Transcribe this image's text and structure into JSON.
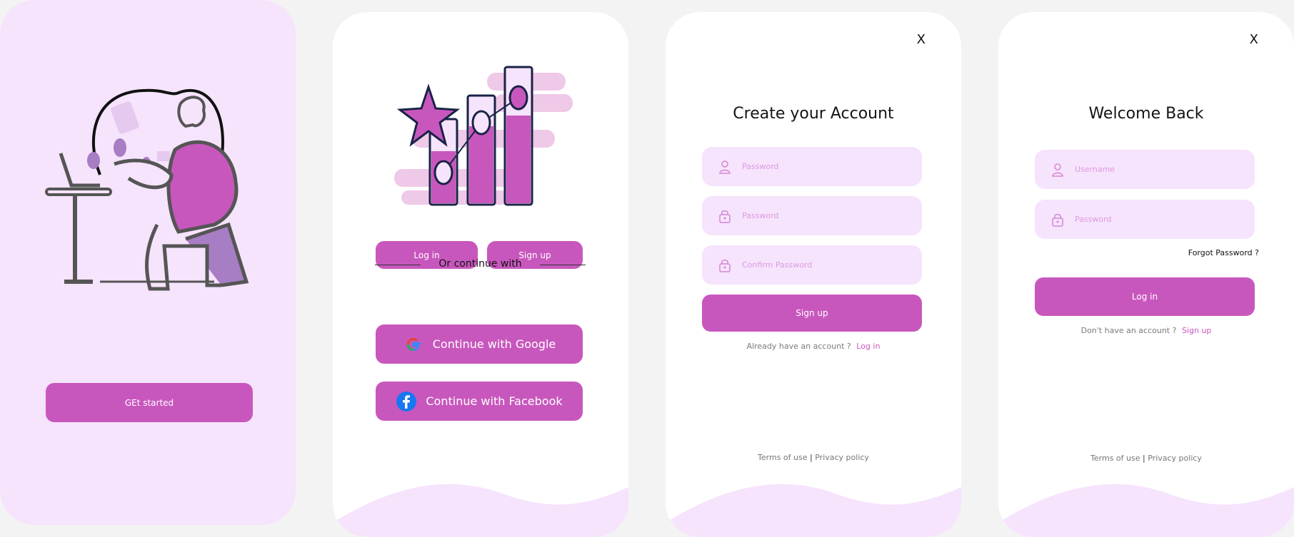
{
  "screen1": {
    "get_started_label": "GEt started"
  },
  "screen2": {
    "login_label": "Log in",
    "signup_label": "Sign up",
    "divider_text": "Or continue  with",
    "google_label": "Continue with Google",
    "facebook_label": "Continue with Facebook"
  },
  "screen3": {
    "close_label": "X",
    "title": "Create your Account",
    "field1_placeholder": "Password",
    "field2_placeholder": "Password",
    "field3_placeholder": "Confirm Password",
    "signup_label": "Sign up",
    "have_account_text": "Already have an account ?",
    "login_link": "Log in",
    "terms": "Terms of use",
    "separator": "|",
    "privacy": "Privacy policy"
  },
  "screen4": {
    "close_label": "X",
    "title": "Welcome Back",
    "username_placeholder": "Username",
    "password_placeholder": "Password",
    "forgot_label": "Forgot Password ?",
    "login_label": "Log in",
    "no_account_text": "Don't  have an account ?",
    "signup_link": "Sign up",
    "terms": "Terms of use",
    "separator": "|",
    "privacy": "Privacy policy"
  },
  "colors": {
    "accent": "#c857bd",
    "light_pink": "#f6e3fc",
    "background": "#f3f3f3"
  },
  "icons": [
    "person-icon",
    "lock-icon",
    "google-icon",
    "facebook-icon",
    "close-icon"
  ]
}
